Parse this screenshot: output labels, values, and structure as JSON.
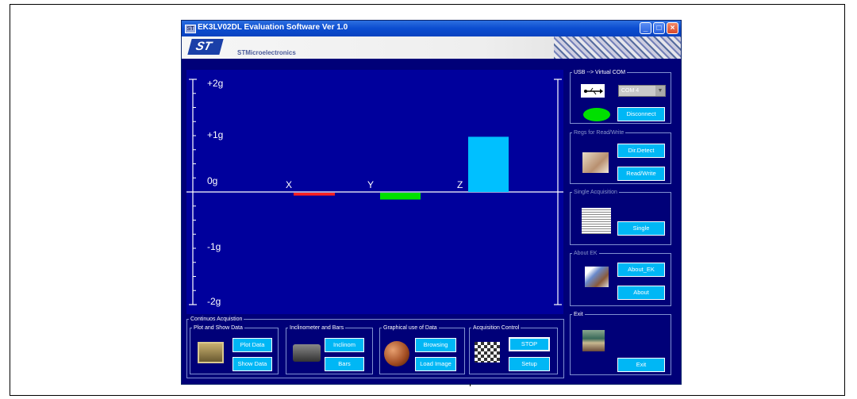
{
  "window": {
    "title": "EK3LV02DL Evaluation Software Ver 1.0",
    "brand": "STMicroelectronics",
    "logo_text": "ST",
    "controls": {
      "minimize": "_",
      "maximize": "□",
      "close": "×"
    }
  },
  "plot": {
    "y_labels": [
      "+2g",
      "+1g",
      "0g",
      "-1g",
      "-2g"
    ],
    "axis_labels": [
      "X",
      "Y",
      "Z"
    ],
    "colors": {
      "background": "#00009c",
      "x": "#ff2020",
      "y": "#00e000",
      "z": "#00c0ff"
    },
    "values_g": {
      "x": -0.05,
      "y": -0.12,
      "z": 0.98
    }
  },
  "usb": {
    "title": "USB --> Virtual COM",
    "port": "COM 4",
    "disconnect": "Disconnect",
    "status_color": "#00e000"
  },
  "register": {
    "title": "Regs for Read/Write",
    "dir_detect": "Dir.Detect",
    "read_write": "Read/Write"
  },
  "single": {
    "title": "Single Acquisition",
    "single": "Single"
  },
  "about": {
    "title": "About EK",
    "about_ek": "About_EK",
    "about": "About"
  },
  "exit": {
    "title": "Exit",
    "exit": "Exit"
  },
  "continuous": {
    "title": "Continuos Acquistion",
    "plot_show": {
      "title": "Plot and Show Data",
      "plot": "Plot Data",
      "show": "Show Data"
    },
    "inclinometer": {
      "title": "Inclinometer and Bars",
      "inclinom": "Inclinom",
      "bars": "Bars"
    },
    "graphical": {
      "title": "Graphical use of Data",
      "browsing": "Browsing",
      "load_image": "Load Image"
    },
    "acq_control": {
      "title": "Acquisition Control",
      "stop": "STOP",
      "setup": "Setup"
    }
  }
}
